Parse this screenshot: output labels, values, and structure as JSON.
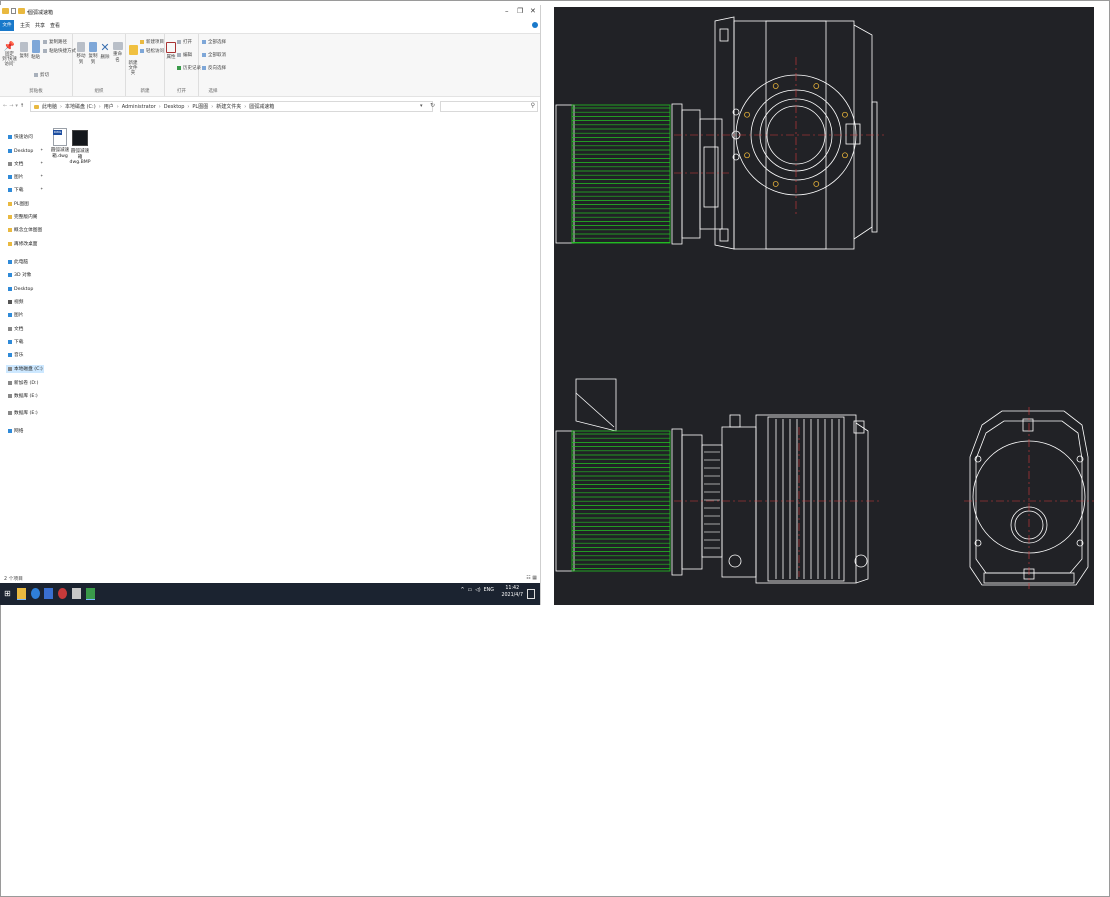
{
  "explorer": {
    "title": "圆弧减速箱",
    "ribbon_tabs": [
      "文件",
      "主页",
      "共享",
      "查看"
    ],
    "ribbon": {
      "clipboard": {
        "label": "剪贴板",
        "pin": "固定到'快速访问'",
        "copy": "复制",
        "paste": "粘贴",
        "copy_path": "复制路径",
        "paste_shortcut": "粘贴快捷方式",
        "cut": "剪切"
      },
      "organize": {
        "label": "组织",
        "move_to": "移动到",
        "copy_to": "复制到",
        "delete": "删除",
        "rename": "重命名"
      },
      "new": {
        "label": "新建",
        "new_folder": "新建\n文件夹",
        "new_item": "新建项目",
        "easy_access": "轻松访问"
      },
      "open": {
        "label": "打开",
        "properties": "属性",
        "open": "打开",
        "edit": "编辑",
        "history": "历史记录"
      },
      "select": {
        "label": "选择",
        "select_all": "全部选择",
        "select_none": "全部取消",
        "invert": "反向选择"
      }
    },
    "breadcrumbs": [
      "此电脑",
      "本地磁盘 (C:)",
      "用户",
      "Administrator",
      "Desktop",
      "PL图图",
      "新建文件夹",
      "圆弧减速箱"
    ],
    "sidebar": [
      {
        "label": "快速访问",
        "icon": "star-icon",
        "color": "blue",
        "y": 0
      },
      {
        "label": "Desktop",
        "icon": "desktop-icon",
        "color": "blue",
        "pinned": true
      },
      {
        "label": "文档",
        "icon": "documents-icon",
        "color": "gray",
        "pinned": true
      },
      {
        "label": "图片",
        "icon": "pictures-icon",
        "color": "blue",
        "pinned": true
      },
      {
        "label": "下载",
        "icon": "download-icon",
        "color": "blue",
        "pinned": true
      },
      {
        "label": "PL图图",
        "icon": "folder-icon",
        "color": "yellow"
      },
      {
        "label": "完整版内阁",
        "icon": "folder-icon",
        "color": "yellow"
      },
      {
        "label": "概念立体图图",
        "icon": "folder-icon",
        "color": "yellow"
      },
      {
        "label": "再修改桌面",
        "icon": "folder-icon",
        "color": "yellow"
      },
      {
        "label": "此电脑",
        "icon": "this-pc-icon",
        "color": "blue"
      },
      {
        "label": "3D 对象",
        "icon": "3d-objects-icon",
        "color": "blue"
      },
      {
        "label": "Desktop",
        "icon": "desktop-icon",
        "color": "blue"
      },
      {
        "label": "视频",
        "icon": "videos-icon",
        "color": "dark"
      },
      {
        "label": "图片",
        "icon": "pictures-icon",
        "color": "blue"
      },
      {
        "label": "文档",
        "icon": "documents-icon",
        "color": "gray"
      },
      {
        "label": "下载",
        "icon": "download-icon",
        "color": "blue"
      },
      {
        "label": "音乐",
        "icon": "music-icon",
        "color": "blue"
      },
      {
        "label": "本地磁盘 (C:)",
        "icon": "drive-icon",
        "color": "gray",
        "selected": true
      },
      {
        "label": "新加卷 (D:)",
        "icon": "drive-icon",
        "color": "gray"
      },
      {
        "label": "数据库 (E:)",
        "icon": "drive-icon",
        "color": "gray"
      },
      {
        "label": "数据库 (E:)",
        "icon": "drive-icon",
        "color": "gray"
      },
      {
        "label": "网络",
        "icon": "network-icon",
        "color": "blue"
      }
    ],
    "files": [
      {
        "name": "圆弧减速箱.dwg",
        "type": "dwg",
        "badge": "DWG"
      },
      {
        "name": "圆弧减速箱dwg.BMP",
        "type": "bmp"
      }
    ],
    "status": "2 个项目",
    "taskbar": {
      "ime": "ENG",
      "time": "11:42",
      "date": "2021/4/7"
    }
  },
  "cad": {
    "background": "#212226",
    "line_color": "#ffffff",
    "motor_color": "#22c322",
    "centerline_color": "#d43a3a",
    "bolt_color": "#e5b23a"
  }
}
